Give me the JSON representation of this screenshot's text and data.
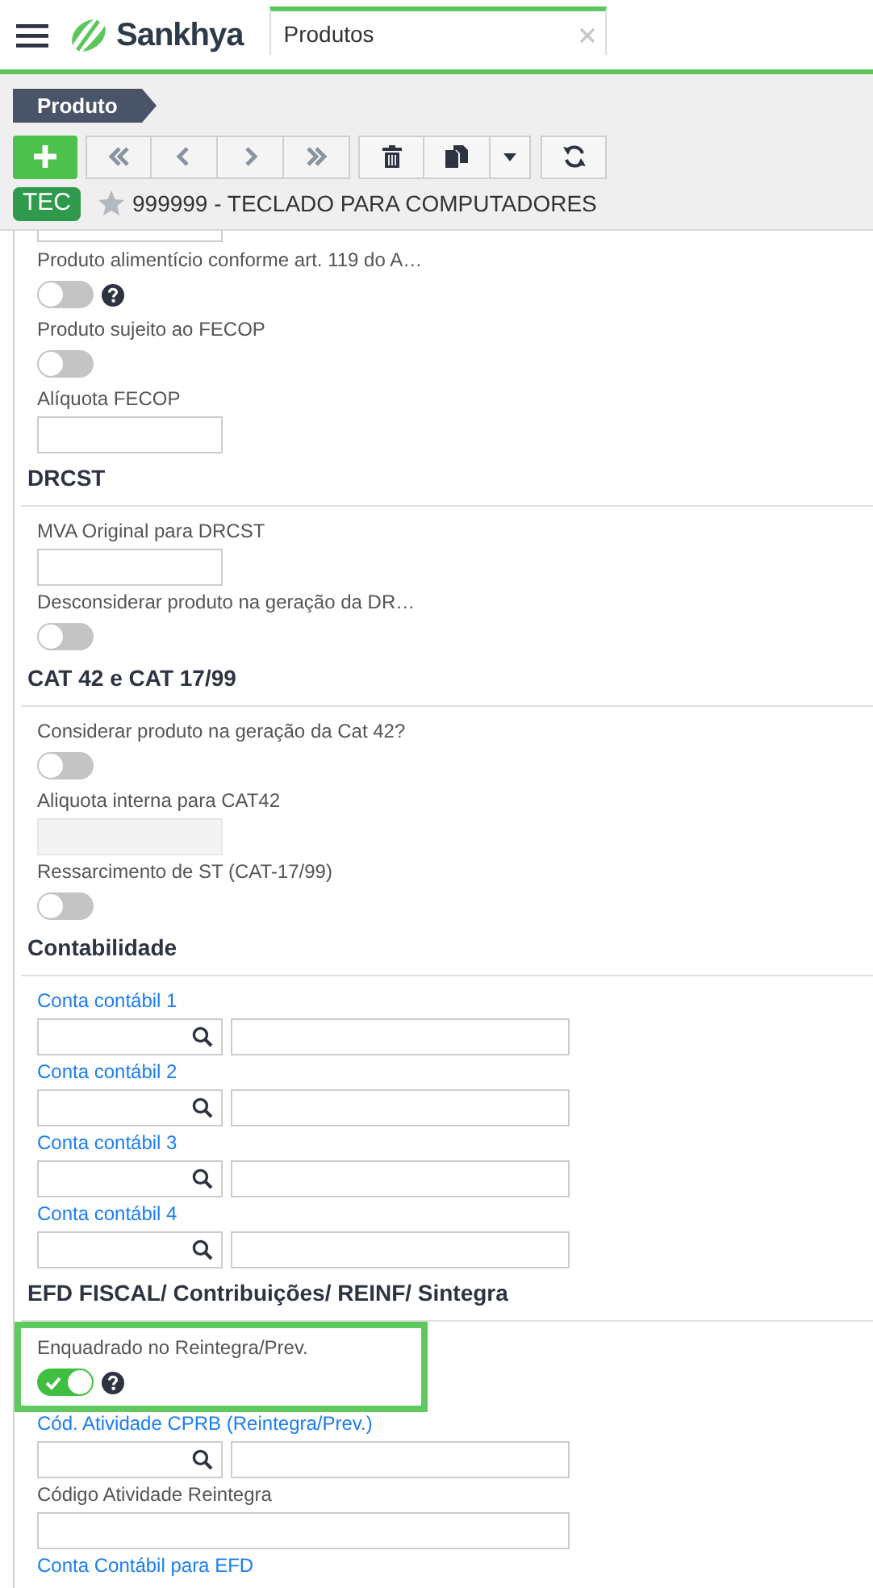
{
  "header": {
    "app_name": "Sankhya",
    "tab": {
      "label": "Produtos",
      "selected": true
    }
  },
  "breadcrumb": "Produto",
  "record": {
    "badge": "TEC",
    "favorite": false,
    "title": "999999 - TECLADO PARA COMPUTADORES"
  },
  "sections": [
    {
      "fields": [
        {
          "kind": "input",
          "clipped": true
        },
        {
          "kind": "toggle",
          "label": "Produto alimentício conforme art. 119 do A…",
          "on": false,
          "help": true
        },
        {
          "kind": "toggle",
          "label": "Produto sujeito ao FECOP",
          "on": false
        },
        {
          "kind": "input",
          "label": "Alíquota FECOP",
          "disabled": false
        }
      ]
    },
    {
      "title": "DRCST",
      "fields": [
        {
          "kind": "input",
          "label": "MVA Original para DRCST",
          "disabled": false
        },
        {
          "kind": "toggle",
          "label": "Desconsiderar produto na geração da DR…",
          "on": false
        }
      ]
    },
    {
      "title": "CAT 42 e CAT 17/99",
      "fields": [
        {
          "kind": "toggle",
          "label": "Considerar produto na geração da Cat 42?",
          "on": false
        },
        {
          "kind": "input",
          "label": "Aliquota interna para CAT42",
          "disabled": true
        },
        {
          "kind": "toggle",
          "label": "Ressarcimento de ST (CAT-17/99)",
          "on": false
        }
      ]
    },
    {
      "title": "Contabilidade",
      "fields": [
        {
          "kind": "lookup",
          "label": "Conta contábil 1",
          "link": true
        },
        {
          "kind": "lookup",
          "label": "Conta contábil 2",
          "link": true
        },
        {
          "kind": "lookup",
          "label": "Conta contábil 3",
          "link": true
        },
        {
          "kind": "lookup",
          "label": "Conta contábil 4",
          "link": true
        }
      ]
    },
    {
      "title": "EFD FISCAL/ Contribuições/ REINF/ Sintegra",
      "fields": [
        {
          "kind": "toggle",
          "label": "Enquadrado no Reintegra/Prev.",
          "on": true,
          "help": true,
          "highlighted": true
        },
        {
          "kind": "lookup",
          "label": "Cód. Atividade CPRB (Reintegra/Prev.)",
          "link": true
        },
        {
          "kind": "wide_input",
          "label": "Código Atividade Reintegra",
          "link": false
        },
        {
          "kind": "label_only",
          "label": "Conta Contábil para EFD",
          "link": true
        }
      ]
    }
  ]
}
